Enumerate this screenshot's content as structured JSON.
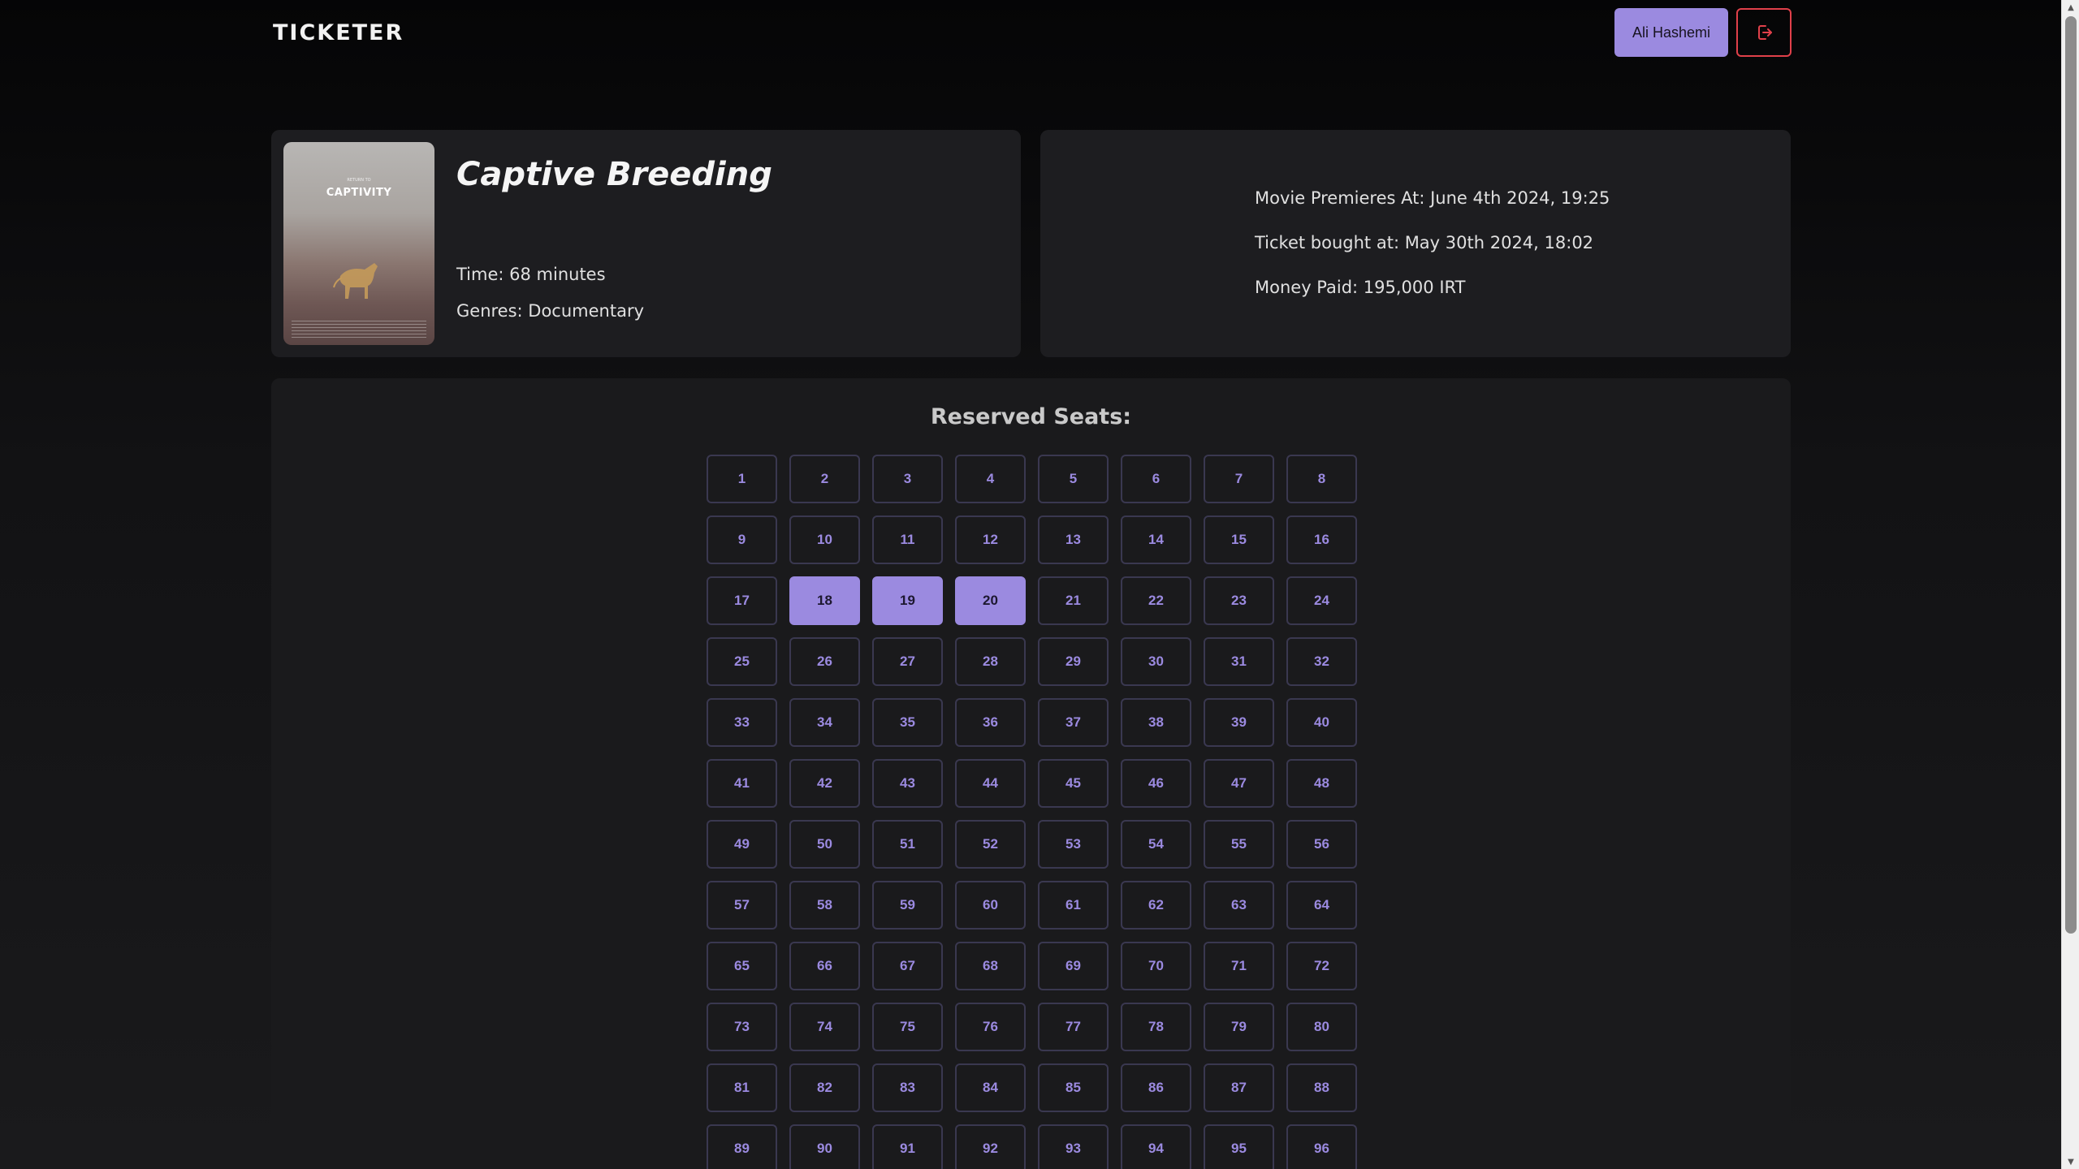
{
  "header": {
    "logo": "TICKETER",
    "user_name": "Ali Hashemi",
    "logout_icon": "logout-icon",
    "logout_color": "#e0404a"
  },
  "movie": {
    "title": "Captive Breeding",
    "time": "Time: 68 minutes",
    "genres": "Genres: Documentary",
    "poster": {
      "title": "CAPTIVITY",
      "subtitle": "RETURN TO"
    }
  },
  "ticket": {
    "premiere": "Movie Premieres At: June 4th 2024, 19:25",
    "bought": "Ticket bought at: May 30th 2024, 18:02",
    "paid": "Money Paid: 195,000 IRT"
  },
  "seats": {
    "title": "Reserved Seats:",
    "reserved": [
      18,
      19,
      20
    ],
    "list": [
      "1",
      "2",
      "3",
      "4",
      "5",
      "6",
      "7",
      "8",
      "9",
      "10",
      "11",
      "12",
      "13",
      "14",
      "15",
      "16",
      "17",
      "18",
      "19",
      "20",
      "21",
      "22",
      "23",
      "24",
      "25",
      "26",
      "27",
      "28",
      "29",
      "30",
      "31",
      "32",
      "33",
      "34",
      "35",
      "36",
      "37",
      "38",
      "39",
      "40",
      "41",
      "42",
      "43",
      "44",
      "45",
      "46",
      "47",
      "48",
      "49",
      "50",
      "51",
      "52",
      "53",
      "54",
      "55",
      "56",
      "57",
      "58",
      "59",
      "60",
      "61",
      "62",
      "63",
      "64",
      "65",
      "66",
      "67",
      "68",
      "69",
      "70",
      "71",
      "72",
      "73",
      "74",
      "75",
      "76",
      "77",
      "78",
      "79",
      "80",
      "81",
      "82",
      "83",
      "84",
      "85",
      "86",
      "87",
      "88",
      "89",
      "90",
      "91",
      "92",
      "93",
      "94",
      "95",
      "96"
    ]
  },
  "colors": {
    "accent": "#9b8ae0",
    "background": "#0d0d0f",
    "card": "#1d1d20"
  }
}
